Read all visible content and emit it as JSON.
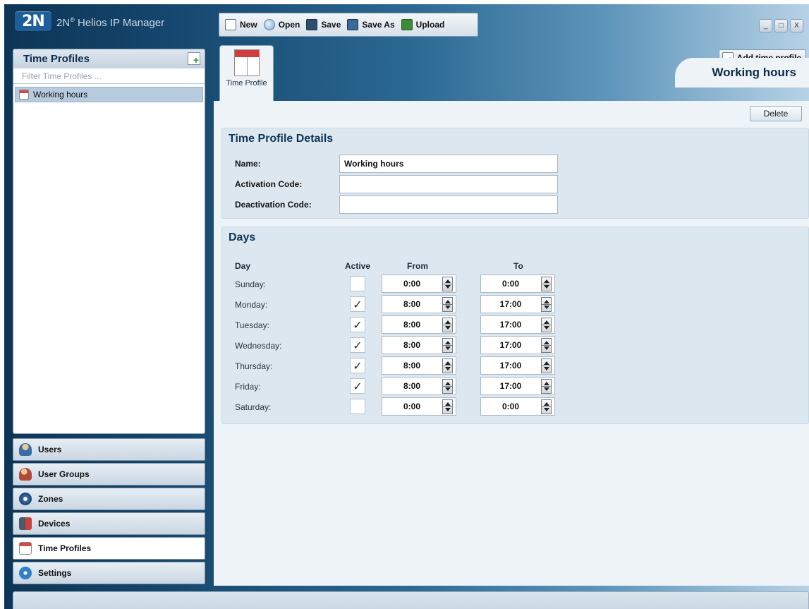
{
  "app": {
    "title": "2N",
    "logo_text": "2N",
    "product": "Helios IP Manager",
    "registered": "®"
  },
  "toolbar": {
    "new_label": "New",
    "open_label": "Open",
    "save_label": "Save",
    "saveas_label": "Save As",
    "upload_label": "Upload"
  },
  "window_controls": {
    "minimize": "_",
    "maximize": "□",
    "close": "X"
  },
  "left_pane": {
    "title": "Time Profiles",
    "filter_placeholder": "Filter Time Profiles ...",
    "items": [
      {
        "label": "Working hours",
        "selected": true
      }
    ]
  },
  "nav": [
    {
      "label": "Users",
      "icon": "users-icon"
    },
    {
      "label": "User Groups",
      "icon": "user-groups-icon"
    },
    {
      "label": "Zones",
      "icon": "zones-icon"
    },
    {
      "label": "Devices",
      "icon": "devices-icon"
    },
    {
      "label": "Time Profiles",
      "icon": "time-profiles-icon",
      "active": true
    },
    {
      "label": "Settings",
      "icon": "settings-icon"
    }
  ],
  "main": {
    "tab_label": "Time Profile",
    "add_button": "Add time profile",
    "profile_title": "Working hours",
    "delete_button": "Delete",
    "details": {
      "title": "Time Profile Details",
      "name_label": "Name:",
      "name_value": "Working hours",
      "activation_label": "Activation Code:",
      "activation_value": "",
      "deactivation_label": "Deactivation Code:",
      "deactivation_value": ""
    },
    "days": {
      "title": "Days",
      "headers": {
        "day": "Day",
        "active": "Active",
        "from": "From",
        "to": "To"
      },
      "rows": [
        {
          "day": "Sunday:",
          "active": false,
          "from": "0:00",
          "to": "0:00"
        },
        {
          "day": "Monday:",
          "active": true,
          "from": "8:00",
          "to": "17:00"
        },
        {
          "day": "Tuesday:",
          "active": true,
          "from": "8:00",
          "to": "17:00"
        },
        {
          "day": "Wednesday:",
          "active": true,
          "from": "8:00",
          "to": "17:00"
        },
        {
          "day": "Thursday:",
          "active": true,
          "from": "8:00",
          "to": "17:00"
        },
        {
          "day": "Friday:",
          "active": true,
          "from": "8:00",
          "to": "17:00"
        },
        {
          "day": "Saturday:",
          "active": false,
          "from": "0:00",
          "to": "0:00"
        }
      ]
    }
  },
  "colors": {
    "accent": "#0f3656",
    "selection": "#b7cbde",
    "panel": "#eef3f8",
    "section": "#dde7f0"
  }
}
